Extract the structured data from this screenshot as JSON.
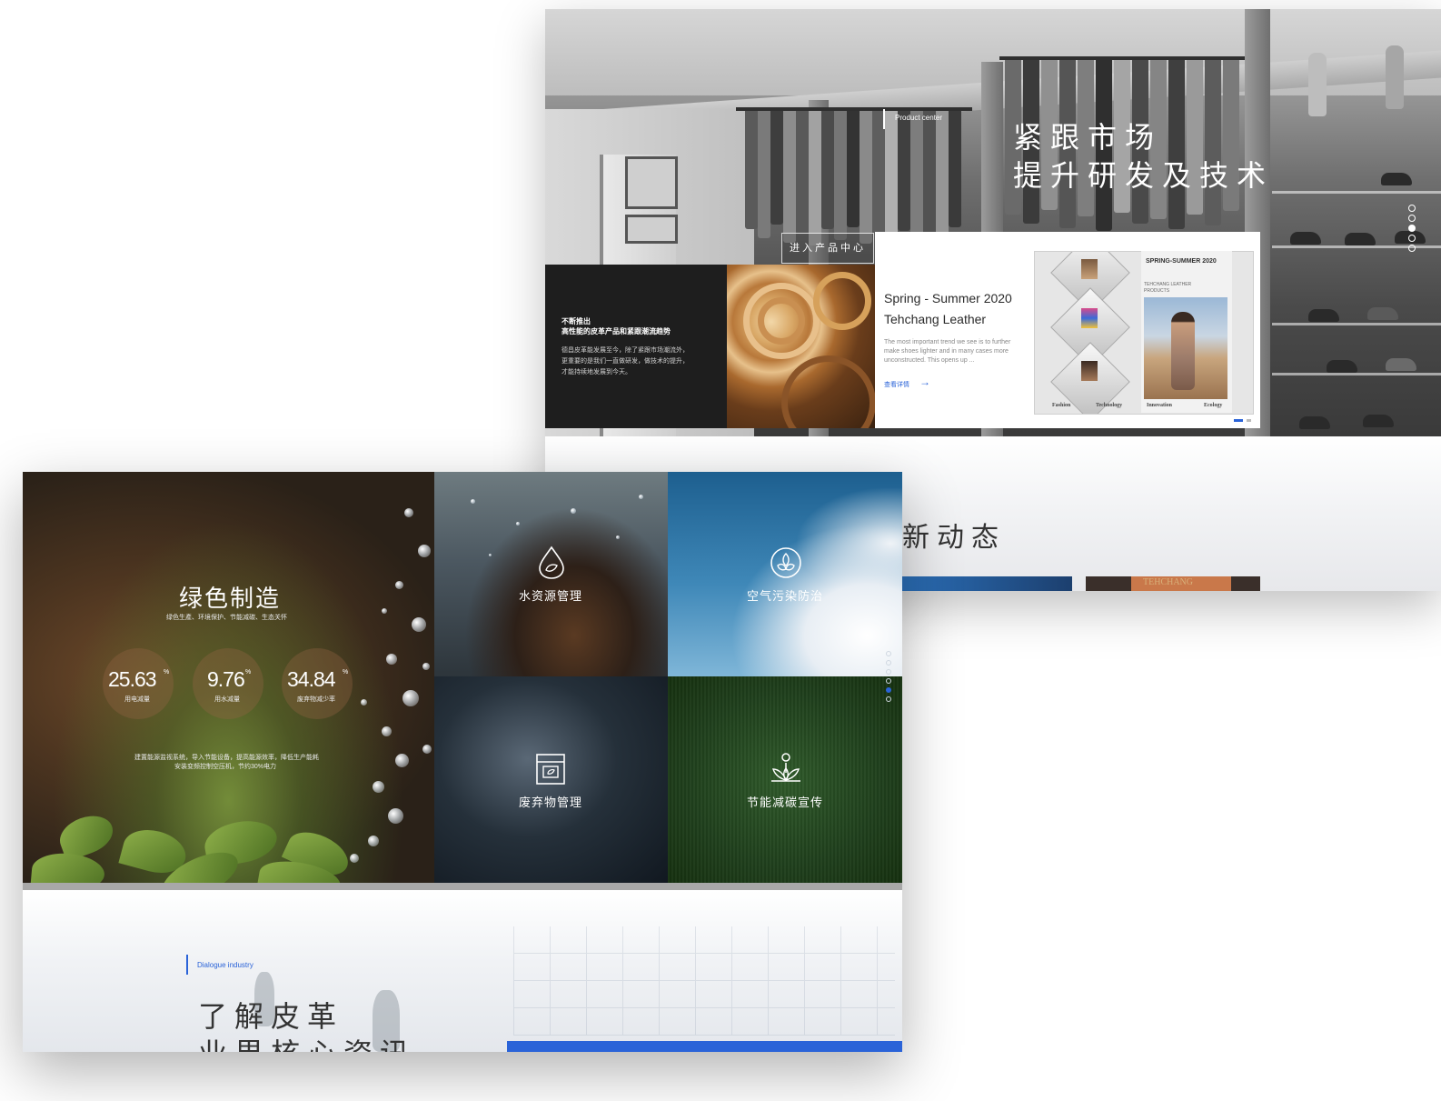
{
  "back_screen": {
    "hero": {
      "subtitle": "Product center",
      "title_line1": "紧跟市场",
      "title_line2": "提升研发及技术",
      "enter_button": "进入产品中心"
    },
    "dark_panel": {
      "title_line1": "不断推出",
      "title_line2": "高性能的皮革产品和紧跟潮流趋势",
      "body_line1": "德昌皮革能发展至今，除了紧跟市场潮流外，",
      "body_line2": "更重要的是我们一直做研发，做技术的提升，",
      "body_line3": "才能持续地发展到今天。"
    },
    "card": {
      "title_line1": "Spring - Summer 2020",
      "title_line2": "Tehchang Leather",
      "description": "The most important trend we see is to further make shoes lighter and in many cases more unconstructed. This opens up ...",
      "link": "查看详情",
      "arrow": "→"
    },
    "poster": {
      "title": "SPRING-SUMMER 2020",
      "subtitle": "TEHCHANG LEATHER PRODUCTS",
      "captions": [
        "Fashion",
        "Technology",
        "Innovation",
        "Ecology"
      ]
    },
    "news": {
      "title": "新动态",
      "strip_label": "TEHCHANG"
    }
  },
  "front_screen": {
    "green": {
      "title": "绿色制造",
      "subtitle": "绿色生產、环境保护、节能减碳、生态关怀",
      "stats": [
        {
          "value": "25.63",
          "unit": "%",
          "label": "用电减量"
        },
        {
          "value": "9.76",
          "unit": "%",
          "label": "用水减量"
        },
        {
          "value": "34.84",
          "unit": "%",
          "label": "废弃物减少率"
        }
      ],
      "note_line1": "建置能源监视系统，导入节能设备，提高能源效率，降低生产能耗",
      "note_line2": "安装变频控制空压机，节约30%电力"
    },
    "tiles": [
      {
        "label": "水资源管理",
        "icon": "water-drop-icon"
      },
      {
        "label": "空气污染防治",
        "icon": "leaf-circle-icon"
      },
      {
        "label": "废弃物管理",
        "icon": "bin-icon"
      },
      {
        "label": "节能减碳宣传",
        "icon": "lotus-person-icon"
      }
    ],
    "lower": {
      "subtitle": "Dialogue industry",
      "title_line1": "了解皮革",
      "title_line2": "业界核心资讯"
    }
  },
  "colors": {
    "accent": "#2a63d8",
    "dark_panel": "#1e1e1e"
  }
}
